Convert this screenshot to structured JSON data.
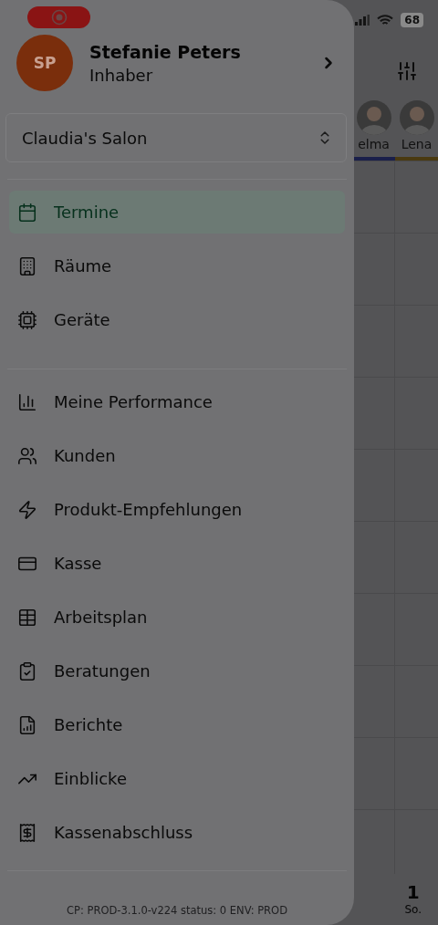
{
  "status_bar": {
    "battery": "68"
  },
  "background": {
    "staff": [
      {
        "name": "elma",
        "color": "#1a1f4a"
      },
      {
        "name": "Lena",
        "color": "#4a3a10"
      }
    ],
    "day_number": "1",
    "day_label": "So."
  },
  "drawer": {
    "recording": true,
    "profile": {
      "initials": "SP",
      "name": "Stefanie Peters",
      "role": "Inhaber"
    },
    "salon_select": {
      "value": "Claudia's Salon"
    },
    "sections": [
      {
        "items": [
          {
            "label": "Termine",
            "selected": true
          },
          {
            "label": "Räume",
            "selected": false
          },
          {
            "label": "Geräte",
            "selected": false
          }
        ]
      },
      {
        "items": [
          {
            "label": "Meine Performance",
            "selected": false
          },
          {
            "label": "Kunden",
            "selected": false
          },
          {
            "label": "Produkt-Empfehlungen",
            "selected": false
          },
          {
            "label": "Kasse",
            "selected": false
          },
          {
            "label": "Arbeitsplan",
            "selected": false
          },
          {
            "label": "Beratungen",
            "selected": false
          },
          {
            "label": "Berichte",
            "selected": false
          },
          {
            "label": "Einblicke",
            "selected": false
          },
          {
            "label": "Kassenabschluss",
            "selected": false
          }
        ]
      }
    ],
    "footer": "CP: PROD-3.1.0-v224 status: 0 ENV: PROD"
  }
}
